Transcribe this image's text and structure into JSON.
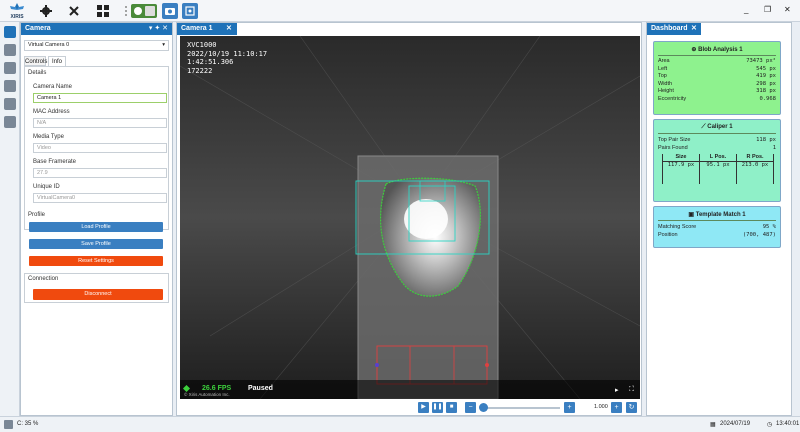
{
  "app": {
    "logo": "XIRIS"
  },
  "toolbar": {
    "icons": [
      "gear-icon",
      "tools-icon",
      "layout-icon",
      "toggle-icon",
      "camera-icon",
      "snapshot-icon"
    ]
  },
  "window": {
    "minimize": "_",
    "restore": "❐",
    "close": "✕"
  },
  "camera_panel": {
    "title": "Camera",
    "camera_select": "Virtual Camera 0",
    "tabs": [
      "Controls",
      "Info"
    ],
    "details_header": "Details",
    "camera_name_label": "Camera Name",
    "camera_name_value": "Camera 1",
    "mac_label": "MAC Address",
    "mac_value": "N/A",
    "media_label": "Media Type",
    "media_value": "Video",
    "framerate_label": "Base Framerate",
    "framerate_value": "27.9",
    "uid_label": "Unique ID",
    "uid_value": "VirtualCamera0",
    "profile_header": "Profile",
    "load_profile": "Load Profile",
    "save_profile": "Save Profile",
    "reset_settings": "Reset Settings",
    "connection_header": "Connection",
    "disconnect": "Disconnect"
  },
  "view_panel": {
    "tab": "Camera 1",
    "overlay": [
      "XVC1000",
      "2022/10/19 11:10:17",
      "1:42:51.306",
      "172222"
    ],
    "fps": "26.6 FPS",
    "state": "Paused",
    "copyright": "© Xiris Automation Inc.",
    "speed": "1.000"
  },
  "dashboard": {
    "tab": "Dashboard",
    "blob": {
      "title": "Blob Analysis 1",
      "rows": [
        {
          "k": "Area",
          "v": "73473 px²"
        },
        {
          "k": "Left",
          "v": "545 px"
        },
        {
          "k": "Top",
          "v": "419 px"
        },
        {
          "k": "Width",
          "v": "298 px"
        },
        {
          "k": "Height",
          "v": "318 px"
        },
        {
          "k": "Eccentricity",
          "v": "0.968"
        }
      ]
    },
    "caliper": {
      "title": "Caliper 1",
      "rows": [
        {
          "k": "Top Pair Size",
          "v": "118 px"
        },
        {
          "k": "Pairs Found",
          "v": "1"
        }
      ],
      "headers": [
        "Size",
        "L Pos.",
        "R Pos."
      ],
      "values": [
        "117.9 px",
        "95.1 px",
        "213.0 px"
      ]
    },
    "template": {
      "title": "Template Match 1",
      "rows": [
        {
          "k": "Matching Score",
          "v": "95 %"
        },
        {
          "k": "Position",
          "v": "(700, 487)"
        }
      ]
    }
  },
  "status": {
    "left": "C: 35 %",
    "date": "2024/07/19",
    "time": "13:40:01"
  },
  "colors": {
    "accent": "#1f72b8",
    "danger": "#f04a0e",
    "blob_card": "#8ef28e",
    "caliper_card": "#8ff0c8",
    "template_card": "#8fe8f5"
  }
}
